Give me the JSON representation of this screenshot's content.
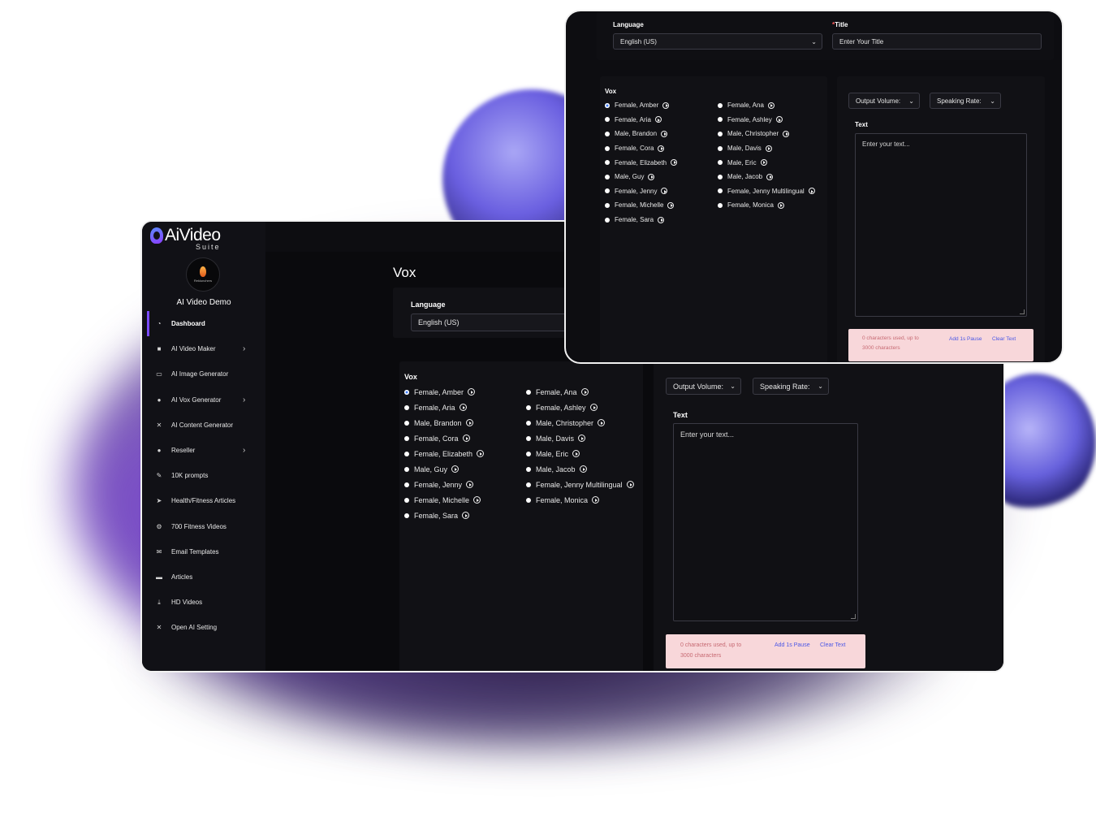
{
  "brand": {
    "name": "AiVideo",
    "sub": "Suite"
  },
  "user": {
    "avatar_caption": "Reklunchers",
    "name": "AI Video Demo"
  },
  "nav": [
    {
      "label": "Dashboard",
      "icon": "dashboard-icon",
      "chevron": false
    },
    {
      "label": "AI Video Maker",
      "icon": "video-camera-icon",
      "chevron": true
    },
    {
      "label": "AI Image Generator",
      "icon": "image-icon",
      "chevron": false
    },
    {
      "label": "AI Vox Generator",
      "icon": "microphone-icon",
      "chevron": true
    },
    {
      "label": "AI Content Generator",
      "icon": "tools-icon",
      "chevron": false
    },
    {
      "label": "Reseller",
      "icon": "users-icon",
      "chevron": true
    },
    {
      "label": "10K prompts",
      "icon": "pen-icon",
      "chevron": false
    },
    {
      "label": "Health/Fitness Articles",
      "icon": "send-icon",
      "chevron": false
    },
    {
      "label": "700 Fitness Videos",
      "icon": "gear-icon",
      "chevron": false
    },
    {
      "label": "Email Templates",
      "icon": "envelope-icon",
      "chevron": false
    },
    {
      "label": "Articles",
      "icon": "card-icon",
      "chevron": false
    },
    {
      "label": "HD Videos",
      "icon": "download-icon",
      "chevron": false
    },
    {
      "label": "Open AI Setting",
      "icon": "tools-icon",
      "chevron": false
    }
  ],
  "main": {
    "title": "Vox",
    "language_label": "Language",
    "language_value": "English (US)",
    "title_label": "Title",
    "title_placeholder": "Enter Your Title",
    "vox_label": "Vox",
    "voices_col1": [
      "Female, Amber",
      "Female, Aria",
      "Male, Brandon",
      "Female, Cora",
      "Female, Elizabeth",
      "Male, Guy",
      "Female, Jenny",
      "Female, Michelle",
      "Female, Sara"
    ],
    "voices_col2": [
      "Female, Ana",
      "Female, Ashley",
      "Male, Christopher",
      "Male, Davis",
      "Male, Eric",
      "Male, Jacob",
      "Female, Jenny Multilingual",
      "Female, Monica"
    ],
    "selected_voice": "Female, Amber",
    "output_volume": "Output Volume:",
    "speaking_rate": "Speaking Rate:",
    "text_label": "Text",
    "text_placeholder": "Enter your text...",
    "chars_used_line1": "0 characters used, up to",
    "chars_used_line2": "3000 characters",
    "add_pause": "Add 1s Pause",
    "clear_text": "Clear Text"
  },
  "colors": {
    "accent": "#7a4bff",
    "info_bg": "#f8d7da",
    "link": "#4b57e6",
    "panel": "#111115"
  }
}
